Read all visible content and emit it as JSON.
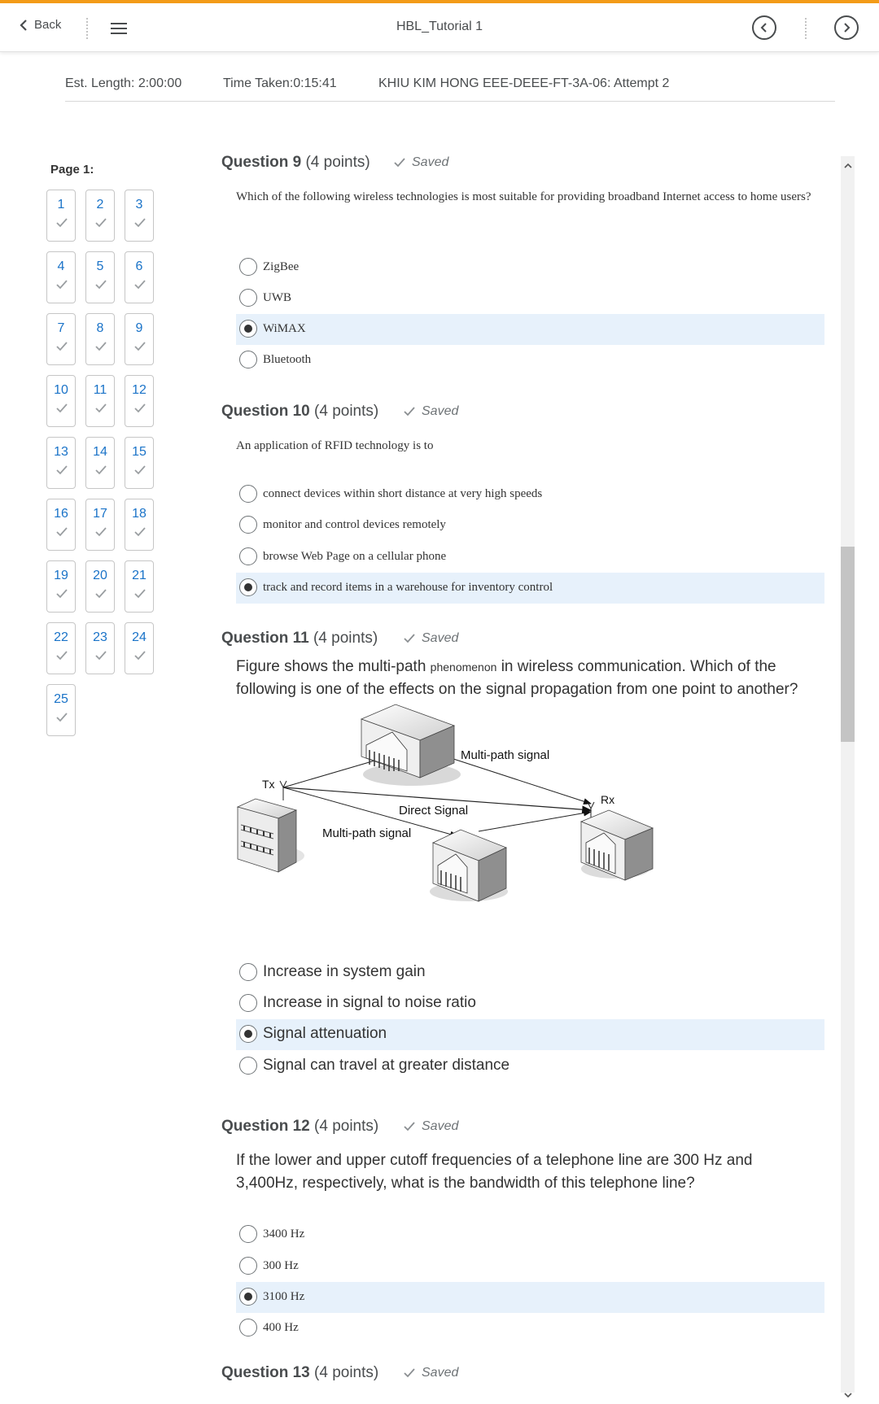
{
  "header": {
    "back_label": "Back",
    "title": "HBL_Tutorial 1",
    "accent_color": "#f39b17"
  },
  "info": {
    "est_length": "Est. Length: 2:00:00",
    "time_taken": "Time Taken:0:15:41",
    "attempt": "KHIU KIM HONG EEE-DEEE-FT-3A-06: Attempt 2"
  },
  "nav": {
    "page_label": "Page 1:",
    "questions": [
      "1",
      "2",
      "3",
      "4",
      "5",
      "6",
      "7",
      "8",
      "9",
      "10",
      "11",
      "12",
      "13",
      "14",
      "15",
      "16",
      "17",
      "18",
      "19",
      "20",
      "21",
      "22",
      "23",
      "24",
      "25"
    ]
  },
  "questions": [
    {
      "title": "Question 9",
      "points": "(4 points)",
      "status": "Saved",
      "text": "Which of the following wireless technologies is most suitable for providing broadband Internet access to home users?",
      "options": [
        "ZigBee",
        "UWB",
        "WiMAX",
        "Bluetooth"
      ],
      "selected": 2
    },
    {
      "title": "Question 10",
      "points": "(4 points)",
      "status": "Saved",
      "text": "An application of RFID technology is to",
      "options": [
        "connect devices within short distance at very high speeds",
        "monitor and control devices remotely",
        "browse Web Page on a cellular phone",
        "track and record items in a warehouse for inventory control"
      ],
      "selected": 3
    },
    {
      "title": "Question 11",
      "points": "(4 points)",
      "status": "Saved",
      "text_a": "Figure shows the multi-path",
      "text_small": "phenomenon",
      "text_b": "in wireless communication. Which of the following is one of the effects on the signal propagation from one point to another?",
      "figure": {
        "tx": "Tx",
        "rx": "Rx",
        "direct": "Direct Signal",
        "multipath_top": "Multi-path signal",
        "multipath_bottom": "Multi-path signal"
      },
      "options": [
        "Increase in system gain",
        "Increase in signal to noise ratio",
        "Signal attenuation",
        "Signal can travel at greater distance"
      ],
      "selected": 2
    },
    {
      "title": "Question 12",
      "points": "(4 points)",
      "status": "Saved",
      "text": "If the lower and upper cutoff frequencies of a telephone line are 300 Hz and 3,400Hz, respectively, what is the bandwidth of this telephone line?",
      "options": [
        "3400 Hz",
        "300 Hz",
        "3100 Hz",
        "400 Hz"
      ],
      "selected": 2
    },
    {
      "title": "Question 13",
      "points": "(4 points)",
      "status": "Saved"
    }
  ]
}
